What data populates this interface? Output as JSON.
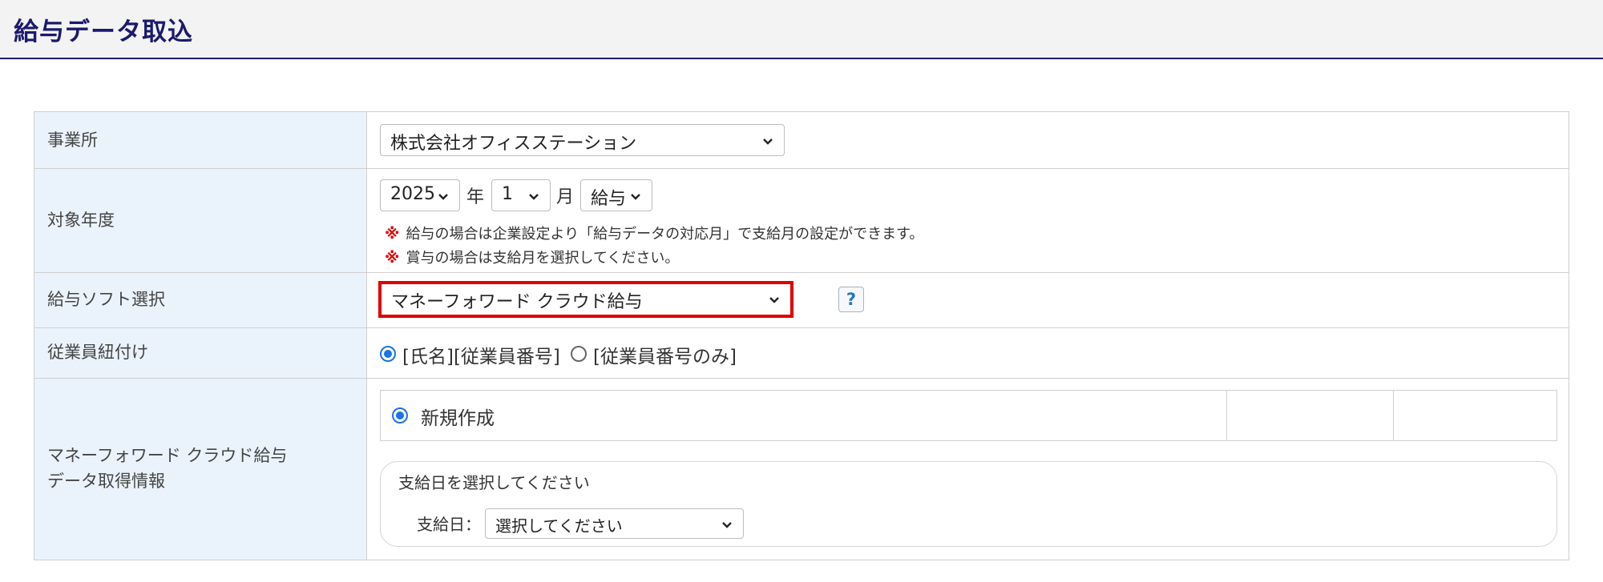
{
  "page": {
    "title": "給与データ取込"
  },
  "colors": {
    "title": "#1a1a6e",
    "label_bg": "#eaf3fb",
    "highlight_border": "#e00000",
    "radio_accent": "#1a73e8",
    "note_mark": "#e00000"
  },
  "rows": {
    "office": {
      "label": "事業所",
      "select_value": "株式会社オフィスステーション"
    },
    "target_period": {
      "label": "対象年度",
      "year_value": "2025",
      "year_unit": "年",
      "month_value": "1",
      "month_unit": "月",
      "type_value": "給与",
      "note_mark": "※",
      "notes": [
        "給与の場合は企業設定より「給与データの対応月」で支給月の設定ができます。",
        "賞与の場合は支給月を選択してください。"
      ]
    },
    "software": {
      "label": "給与ソフト選択",
      "select_value": "マネーフォワード クラウド給与",
      "help_label": "?"
    },
    "employee_link": {
      "label": "従業員紐付け",
      "option1": "[氏名][従業員番号]",
      "option2": "[従業員番号のみ]"
    },
    "data_info": {
      "label_line1": "マネーフォワード クラウド給与",
      "label_line2": "データ取得情報",
      "new_label": "新規作成",
      "payday_heading": "支給日を選択してください",
      "payday_label": "支給日：",
      "payday_select": "選択してください"
    }
  },
  "icons": {
    "select_arrow": "chevron-down-icon",
    "help": "question-icon"
  }
}
